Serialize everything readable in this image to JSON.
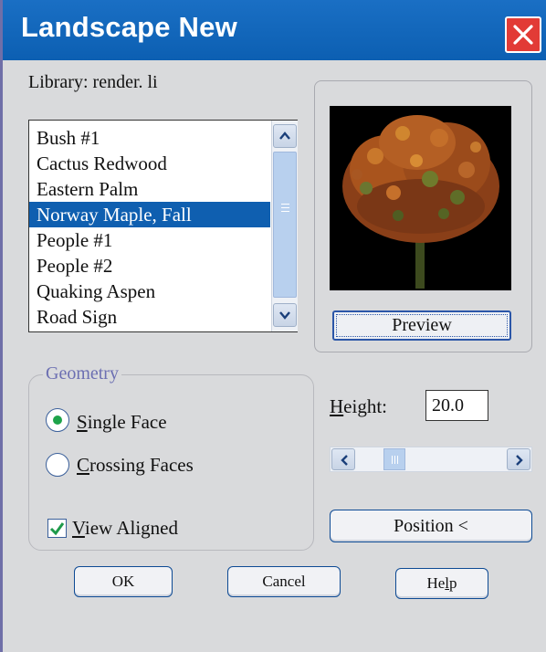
{
  "window": {
    "title": "Landscape New",
    "accent": "#0c5fb2",
    "close_color": "#e23b36"
  },
  "library": {
    "label": "Library: render. li"
  },
  "list": {
    "items": [
      "Bush #1",
      "Cactus Redwood",
      "Eastern Palm",
      "Norway Maple, Fall",
      "People #1",
      "People #2",
      "Quaking Aspen",
      "Road Sign"
    ],
    "selected_index": 3,
    "selected_color": "#0f5fb0"
  },
  "preview": {
    "image": "autumn-maple-tree",
    "button_label": "Preview"
  },
  "geometry": {
    "legend": "Geometry",
    "single_face": {
      "underline": "S",
      "rest": "ingle Face",
      "checked": true
    },
    "crossing_faces": {
      "pre": "",
      "underline": "C",
      "mid": "rossin",
      "underline2": "g",
      "rest": " Faces",
      "checked": false
    },
    "view_aligned": {
      "underline": "V",
      "rest": "iew Aligned",
      "checked": true
    }
  },
  "height": {
    "label_underline": "H",
    "label_rest": "eight:",
    "value": "20.0"
  },
  "buttons": {
    "position": "Position <",
    "ok": "OK",
    "cancel": "Cancel",
    "help_pre": "He",
    "help_underline": "l",
    "help_post": "p"
  }
}
